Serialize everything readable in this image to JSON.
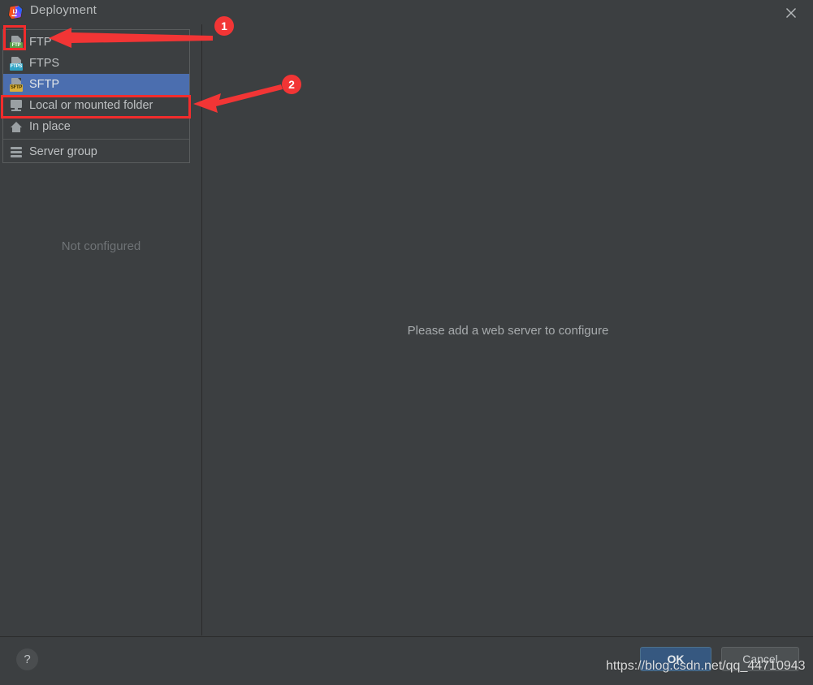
{
  "window": {
    "title": "Deployment",
    "app_icon": "intellij-idea-icon",
    "close_icon": "close-icon"
  },
  "toolbar": {
    "add_label": "+",
    "add_icon": "plus-icon",
    "remove_label": "–",
    "remove_icon": "minus-icon"
  },
  "type_menu": {
    "items": [
      {
        "label": "FTP",
        "icon": "ftp-server-icon",
        "tag": "FTP",
        "selected": false
      },
      {
        "label": "FTPS",
        "icon": "ftps-server-icon",
        "tag": "FTPS",
        "selected": false
      },
      {
        "label": "SFTP",
        "icon": "sftp-server-icon",
        "tag": "SFTP",
        "selected": true
      },
      {
        "label": "Local or mounted folder",
        "icon": "monitor-icon",
        "tag": "",
        "selected": false
      },
      {
        "label": "In place",
        "icon": "home-icon",
        "tag": "",
        "selected": false
      },
      {
        "label": "Server group",
        "icon": "server-group-icon",
        "tag": "",
        "selected": false
      }
    ]
  },
  "left_panel": {
    "empty_text": "Not configured"
  },
  "right_panel": {
    "empty_text": "Please add a web server to configure"
  },
  "bottom": {
    "help_label": "?",
    "help_icon": "question-mark-icon",
    "ok_label": "OK",
    "cancel_label": "Cancel"
  },
  "annotations": {
    "badge_1": "1",
    "badge_2": "2",
    "highlight_color": "#f22c2c",
    "arrow_color": "#f23535"
  },
  "watermark": {
    "text": "https://blog.csdn.net/qq_44710943"
  },
  "colors": {
    "dialog_bg": "#3c3f41",
    "selection_blue": "#4b6eaf",
    "ok_button": "#365880",
    "text": "#bbbbbb",
    "muted_text": "#6f7376"
  }
}
